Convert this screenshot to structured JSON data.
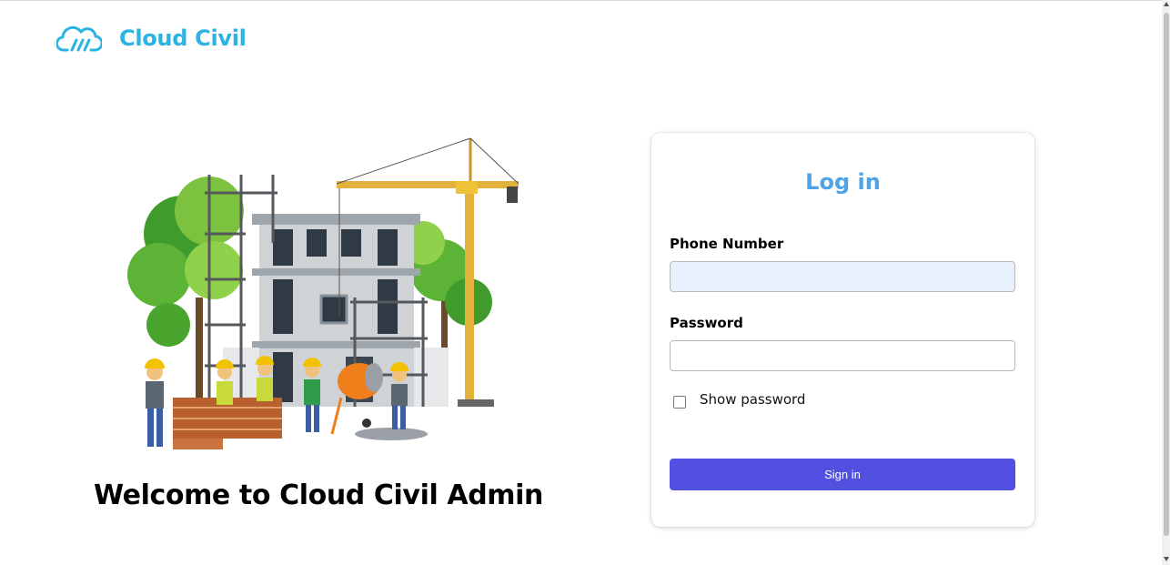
{
  "brand": {
    "name": "Cloud Civil",
    "logo_icon": "cloud-bars-icon",
    "color": "#2bb3e3"
  },
  "hero": {
    "illustration": "building-construction-illustration",
    "welcome_text": "Welcome to Cloud Civil Admin"
  },
  "login": {
    "title": "Log in",
    "title_color": "#4ea3e9",
    "phone_label": "Phone Number",
    "phone_value": "",
    "password_label": "Password",
    "password_value": "",
    "show_password_label": "Show password",
    "show_password_checked": false,
    "submit_label": "Sign in",
    "submit_color": "#5150e0"
  }
}
